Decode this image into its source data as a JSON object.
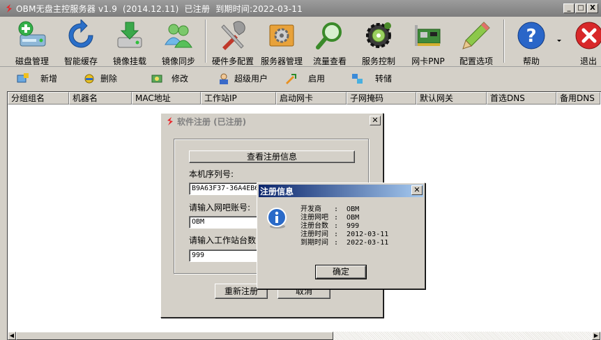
{
  "titlebar": {
    "title": "OBM无盘主控服务器 v1.9  (2014.12.11)  已注册  到期时间:2022-03-11",
    "minimize": "_",
    "maximize": "□",
    "close": "X"
  },
  "toolbar": {
    "items": [
      {
        "label": "磁盘管理",
        "icon": "disk-add-icon"
      },
      {
        "label": "智能缓存",
        "icon": "refresh-icon"
      },
      {
        "label": "镜像挂载",
        "icon": "disk-download-icon"
      },
      {
        "label": "镜像同步",
        "icon": "users-icon"
      },
      {
        "label": "硬件多配置",
        "icon": "tools-icon"
      },
      {
        "label": "服务器管理",
        "icon": "server-gear-icon"
      },
      {
        "label": "流量查看",
        "icon": "magnifier-icon"
      },
      {
        "label": "服务控制",
        "icon": "service-gear-icon"
      },
      {
        "label": "网卡PNP",
        "icon": "network-card-icon"
      },
      {
        "label": "配置选项",
        "icon": "pencil-icon"
      },
      {
        "label": "帮助",
        "icon": "help-icon"
      },
      {
        "label": "退出",
        "icon": "exit-icon"
      }
    ]
  },
  "toolbar2": {
    "items": [
      {
        "label": "新增",
        "icon": "add-icon"
      },
      {
        "label": "删除",
        "icon": "delete-icon"
      },
      {
        "label": "修改",
        "icon": "edit-icon"
      },
      {
        "label": "超级用户",
        "icon": "user-icon"
      },
      {
        "label": "启用",
        "icon": "enable-icon"
      },
      {
        "label": "转储",
        "icon": "transfer-icon"
      }
    ]
  },
  "table": {
    "columns": [
      "分组组名",
      "机器名",
      "MAC地址",
      "工作站IP",
      "启动网卡",
      "子网掩码",
      "默认网关",
      "首选DNS",
      "备用DNS"
    ],
    "rows": []
  },
  "reg_dialog": {
    "title": "软件注册 (已注册)",
    "view_info_button": "查看注册信息",
    "serial_label": "本机序列号:",
    "serial_value": "B9A63F37-36A4EB6",
    "account_label": "请输入网吧账号:",
    "account_value": "OBM",
    "count_label": "请输入工作站台数",
    "count_value": "999",
    "reregister_button": "重新注册",
    "cancel_button": "取消"
  },
  "info_dialog": {
    "title": "注册信息",
    "lines": [
      {
        "key": "开发商",
        "value": ":  OBM"
      },
      {
        "key": "注册网吧",
        "value": ":  OBM"
      },
      {
        "key": "注册台数",
        "value": ":  999"
      },
      {
        "key": "注册时间",
        "value": ":  2012-03-11"
      },
      {
        "key": "到期时间",
        "value": ":  2022-03-11"
      }
    ],
    "ok_button": "确定"
  }
}
